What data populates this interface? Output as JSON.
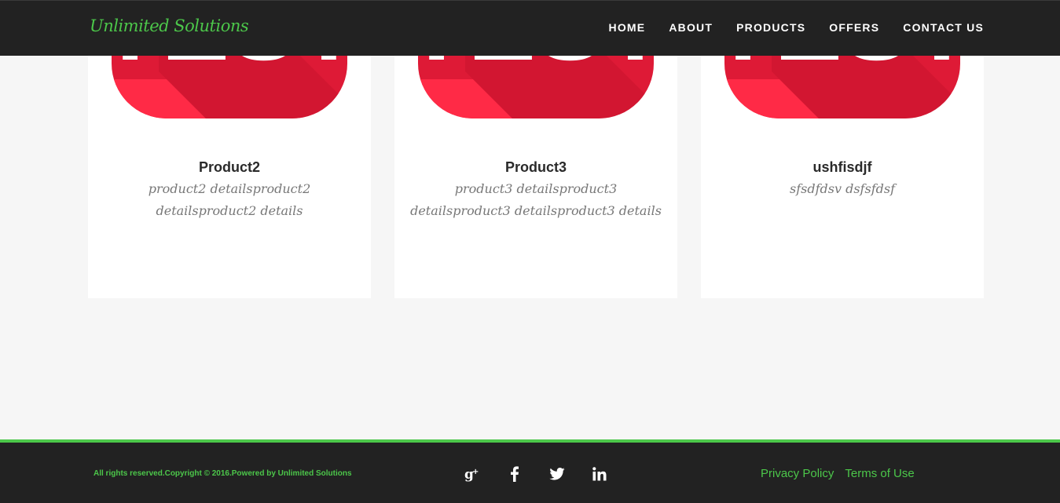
{
  "brand": "Unlimited Solutions",
  "nav": [
    "HOME",
    "ABOUT",
    "PRODUCTS",
    "OFFERS",
    "CONTACT US"
  ],
  "products": [
    {
      "name": "Product2",
      "details": "product2 detailsproduct2 detailsproduct2 details",
      "image_text": "TEST"
    },
    {
      "name": "Product3",
      "details": "product3 detailsproduct3 detailsproduct3 detailsproduct3 details",
      "image_text": "TEST"
    },
    {
      "name": "ushfisdjf",
      "details": "sfsdfdsv dsfsfdsf",
      "image_text": "TEST"
    }
  ],
  "footer": {
    "copyright": "All rights reserved.Copyright © 2016.Powered by Unlimited Solutions",
    "social": [
      "google-plus-icon",
      "facebook-icon",
      "twitter-icon",
      "linkedin-icon"
    ],
    "privacy": "Privacy Policy",
    "terms": "Terms of Use"
  },
  "colors": {
    "accent": "#4cc74a",
    "dark": "#222222",
    "product_red": "#e8203c"
  }
}
